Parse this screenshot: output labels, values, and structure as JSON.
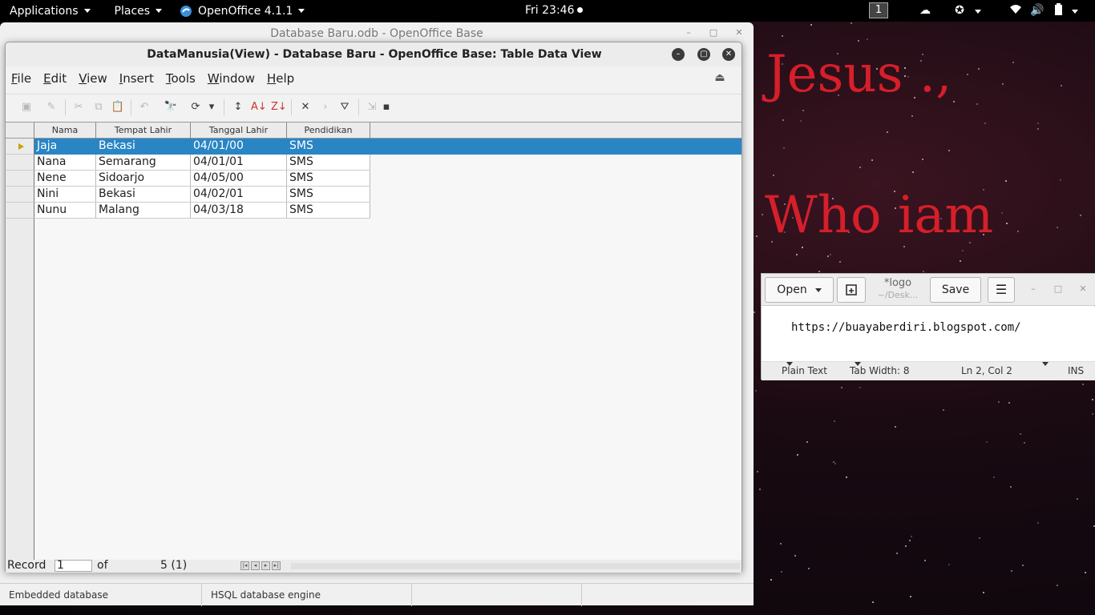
{
  "top_panel": {
    "applications": "Applications",
    "places": "Places",
    "active_app": "OpenOffice 4.1.1",
    "clock": "Fri 23:46",
    "workspace": "1",
    "icons": [
      "weather-icon",
      "accessibility-icon",
      "wifi-icon",
      "volume-icon",
      "battery-icon"
    ]
  },
  "wallpaper": {
    "line1": "Jesus .,",
    "line2": "Who iam",
    "text_color": "#d51f2a"
  },
  "back_window": {
    "title": "Database Baru.odb - OpenOffice Base",
    "status": [
      "Embedded database",
      "HSQL database engine",
      "",
      ""
    ]
  },
  "main_window": {
    "title": "DataManusia(View) - Database Baru - OpenOffice Base: Table Data View",
    "menu": [
      "File",
      "Edit",
      "View",
      "Insert",
      "Tools",
      "Window",
      "Help"
    ],
    "menu_mnemonic": [
      "F",
      "E",
      "V",
      "I",
      "T",
      "W",
      "H"
    ],
    "columns": [
      "Nama",
      "Tempat Lahir",
      "Tanggal Lahir",
      "Pendidikan"
    ],
    "rows": [
      [
        "Jaja",
        "Bekasi",
        "04/01/00",
        "SMS"
      ],
      [
        "Nana",
        "Semarang",
        "04/01/01",
        "SMS"
      ],
      [
        "Nene",
        "Sidoarjo",
        "04/05/00",
        "SMS"
      ],
      [
        "Nini",
        "Bekasi",
        "04/02/01",
        "SMS"
      ],
      [
        "Nunu",
        "Malang",
        "04/03/18",
        "SMS"
      ]
    ],
    "selected_row": 0,
    "selection_color": "#2a85c4",
    "record_bar": {
      "record_label": "Record",
      "record_value": "1",
      "of_label": "of",
      "count": "5 (1)"
    }
  },
  "gedit": {
    "open_label": "Open",
    "title": "*logo",
    "subtitle": "~/Desk...",
    "save_label": "Save",
    "content": "https://buayaberdiri.blogspot.com/",
    "status": {
      "language": "Plain Text",
      "tab_width": "Tab Width: 8",
      "position": "Ln 2, Col 2",
      "mode": "INS"
    }
  }
}
